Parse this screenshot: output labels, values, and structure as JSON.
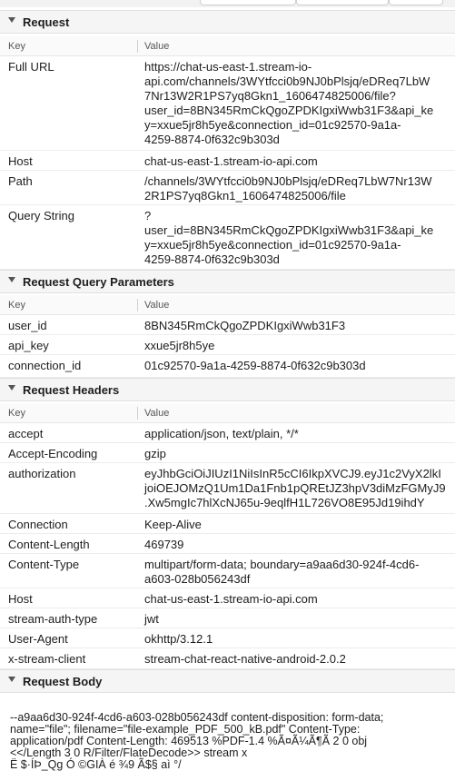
{
  "sections": {
    "request": "Request",
    "query_params": "Request Query Parameters",
    "headers": "Request Headers",
    "body": "Request Body"
  },
  "columns": {
    "key": "Key",
    "value": "Value"
  },
  "request": {
    "full_url": {
      "key": "Full URL",
      "lines": [
        "https://chat-us-east-1.stream-io-",
        "api.com/channels/3WYtfcci0b9NJ0bPlsjq/eDReq7LbW",
        "7Nr13W2R1PS7yq8Gkn1_1606474825006/file?",
        "user_id=8BN345RmCkQgoZPDKIgxiWwb31F3&api_ke",
        "y=xxue5jr8h5ye&connection_id=01c92570-9a1a-",
        "4259-8874-0f632c9b303d"
      ]
    },
    "host": {
      "key": "Host",
      "lines": [
        "chat-us-east-1.stream-io-api.com"
      ]
    },
    "path": {
      "key": "Path",
      "lines": [
        "/channels/3WYtfcci0b9NJ0bPlsjq/eDReq7LbW7Nr13W",
        "2R1PS7yq8Gkn1_1606474825006/file"
      ]
    },
    "query_string": {
      "key": "Query String",
      "lines": [
        "?",
        "user_id=8BN345RmCkQgoZPDKIgxiWwb31F3&api_ke",
        "y=xxue5jr8h5ye&connection_id=01c92570-9a1a-",
        "4259-8874-0f632c9b303d"
      ]
    }
  },
  "query_params": [
    {
      "key": "user_id",
      "value": "8BN345RmCkQgoZPDKIgxiWwb31F3"
    },
    {
      "key": "api_key",
      "value": "xxue5jr8h5ye"
    },
    {
      "key": "connection_id",
      "value": "01c92570-9a1a-4259-8874-0f632c9b303d"
    }
  ],
  "headers": [
    {
      "key": "accept",
      "lines": [
        "application/json, text/plain, */*"
      ]
    },
    {
      "key": "Accept-Encoding",
      "lines": [
        "gzip"
      ]
    },
    {
      "key": "authorization",
      "lines": [
        "eyJhbGciOiJIUzI1NiIsInR5cCI6IkpXVCJ9.eyJ1c2VyX2lkI",
        "joiOEJOMzQ1Um1Da1Fnb1pQREtJZ3hpV3diMzFGMyJ9",
        ".Xw5mgIc7hlXcNJ65u-9eqlfH1L726VO8E95Jd19ihdY"
      ]
    },
    {
      "key": "Connection",
      "lines": [
        "Keep-Alive"
      ]
    },
    {
      "key": "Content-Length",
      "lines": [
        "469739"
      ]
    },
    {
      "key": "Content-Type",
      "lines": [
        "multipart/form-data; boundary=a9aa6d30-924f-4cd6-",
        "a603-028b056243df"
      ]
    },
    {
      "key": "Host",
      "lines": [
        "chat-us-east-1.stream-io-api.com"
      ]
    },
    {
      "key": "stream-auth-type",
      "lines": [
        "jwt"
      ]
    },
    {
      "key": "User-Agent",
      "lines": [
        "okhttp/3.12.1"
      ]
    },
    {
      "key": "x-stream-client",
      "lines": [
        "stream-chat-react-native-android-2.0.2"
      ]
    }
  ],
  "body_lines": [
    "--a9aa6d30-924f-4cd6-a603-028b056243df content-disposition: form-data;",
    "name=\"file\"; filename=\"file-example_PDF_500_kB.pdf\" Content-Type:",
    "application/pdf Content-Length: 469513 %PDF-1.4 %Ã¤Ã¼Ã¶Ã    2 0 obj",
    "<</Length 3 0 R/Filter/FlateDecode>> stream x",
    "Ë    $·ÍÞ_Qg  Ó ©GIÀ        é    ¾9    Ã$§    aì °/"
  ]
}
